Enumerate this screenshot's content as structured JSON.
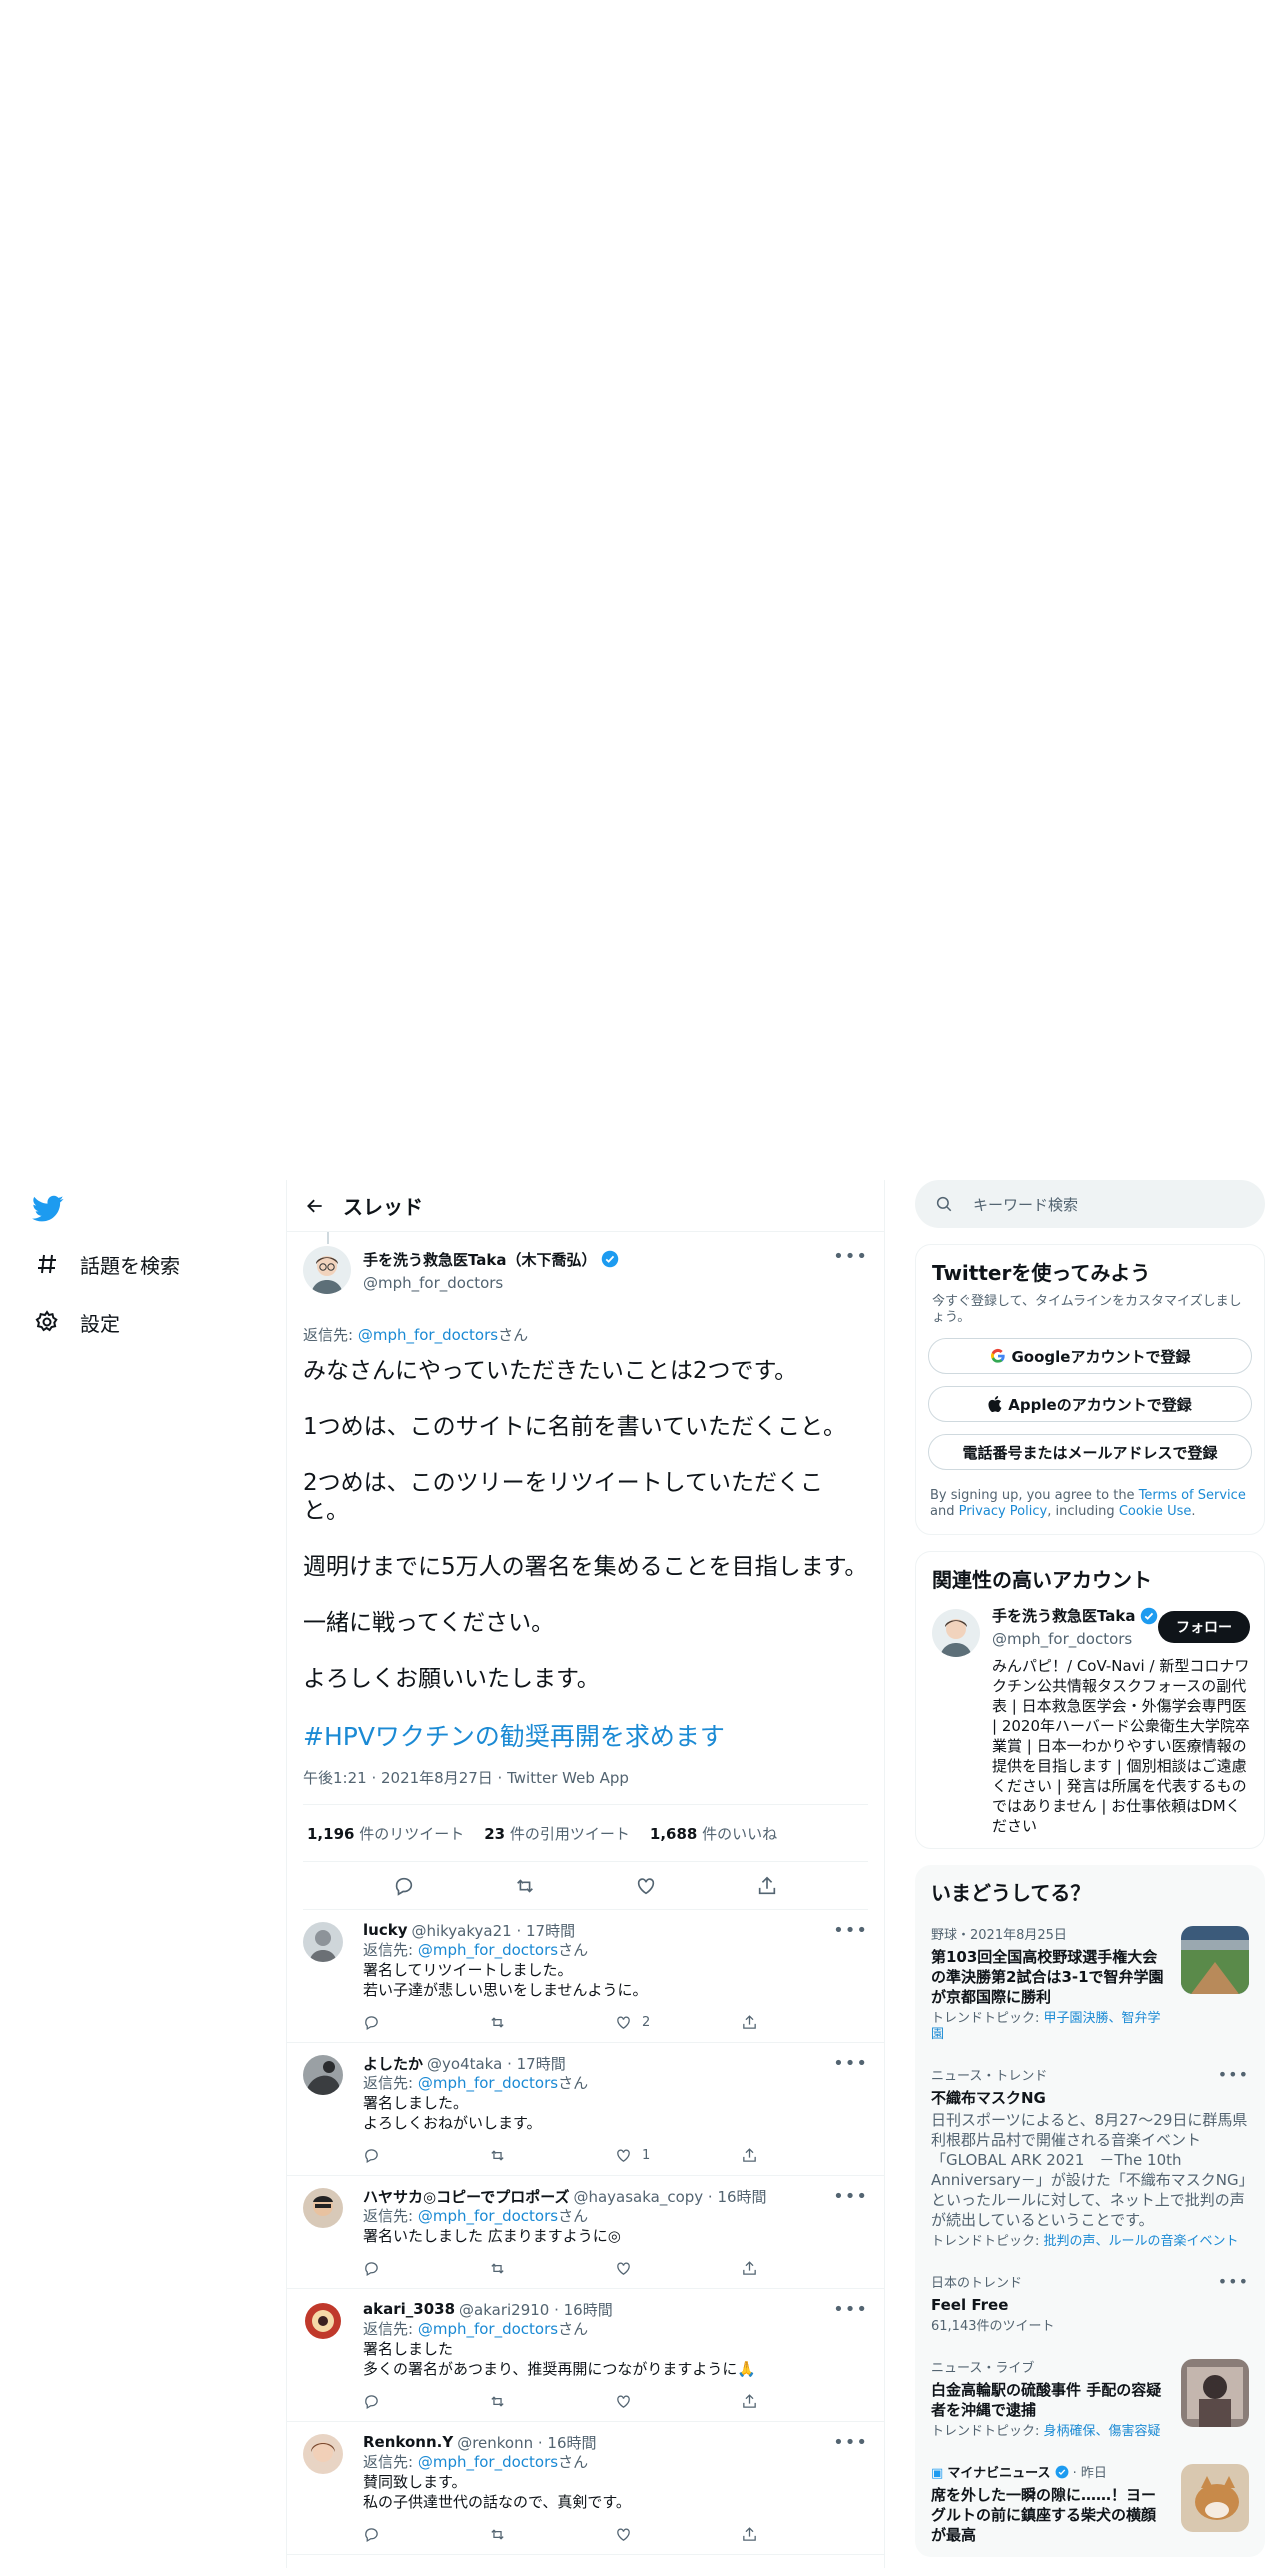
{
  "nav": {
    "items": [
      {
        "label": "話題を検索",
        "icon": "hashtag-icon"
      },
      {
        "label": "設定",
        "icon": "gear-icon"
      }
    ]
  },
  "header": {
    "title": "スレッド"
  },
  "main_tweet": {
    "display_name": "手を洗う救急医Taka（木下喬弘）",
    "handle": "@mph_for_doctors",
    "reply_prefix": "返信先: ",
    "reply_to": "@mph_for_doctors",
    "reply_suffix": "さん",
    "paragraphs": [
      "みなさんにやっていただきたいことは2つです。",
      "1つめは、このサイトに名前を書いていただくこと。",
      "2つめは、このツリーをリツイートしていただくこと。",
      "週明けまでに5万人の署名を集めることを目指します。",
      "一緒に戦ってください。",
      "よろしくお願いいたします。"
    ],
    "hashtag": "#HPVワクチンの勧奨再開を求めます",
    "meta": "午後1:21 · 2021年8月27日 · Twitter Web App",
    "stats": {
      "retweets_num": "1,196",
      "retweets_label": " 件のリツイート",
      "quotes_num": "23",
      "quotes_label": " 件の引用ツイート",
      "likes_num": "1,688",
      "likes_label": " 件のいいね"
    }
  },
  "replies": [
    {
      "name": "lucky",
      "handle": "@hikyakya21 · 17時間",
      "reply_prefix": "返信先: ",
      "reply_to": "@mph_for_doctors",
      "reply_suffix": "さん",
      "lines": [
        "署名してリツイートしました。",
        "若い子達が悲しい思いをしませんように。"
      ],
      "likes": "2"
    },
    {
      "name": "よしたか",
      "handle": "@yo4taka · 17時間",
      "reply_prefix": "返信先: ",
      "reply_to": "@mph_for_doctors",
      "reply_suffix": "さん",
      "lines": [
        "署名しました。",
        "よろしくおねがいします。"
      ],
      "likes": "1"
    },
    {
      "name": "ハヤサカ◎コピーでプロポーズ",
      "handle": "@hayasaka_copy · 16時間",
      "reply_prefix": "返信先: ",
      "reply_to": "@mph_for_doctors",
      "reply_suffix": "さん",
      "lines": [
        "署名いたしました 広まりますように◎"
      ],
      "likes": ""
    },
    {
      "name": "akari_3038",
      "handle": "@akari2910 · 16時間",
      "reply_prefix": "返信先: ",
      "reply_to": "@mph_for_doctors",
      "reply_suffix": "さん",
      "lines": [
        "署名しました",
        "多くの署名があつまり、推奨再開につながりますように🙏"
      ],
      "likes": ""
    },
    {
      "name": "Renkonn.Y",
      "handle": "@renkonn · 16時間",
      "reply_prefix": "返信先: ",
      "reply_to": "@mph_for_doctors",
      "reply_suffix": "さん",
      "lines": [
        "賛同致します。",
        "私の子供達世代の話なので、真剣です。"
      ],
      "likes": ""
    }
  ],
  "search": {
    "placeholder": "キーワード検索"
  },
  "signup": {
    "title": "Twitterを使ってみよう",
    "subtitle": "今すぐ登録して、タイムラインをカスタマイズしましょう。",
    "google": "Googleアカウントで登録",
    "apple": "Appleのアカウントで登録",
    "phone": "電話番号またはメールアドレスで登録",
    "legal_1": "By signing up, you agree to the ",
    "terms": "Terms of Service",
    "legal_2": " and ",
    "privacy": "Privacy Policy",
    "legal_3": ", including ",
    "cookie": "Cookie Use",
    "legal_4": "."
  },
  "related": {
    "title": "関連性の高いアカウント",
    "name": "手を洗う救急医Taka",
    "handle": "@mph_for_doctors",
    "follow": "フォロー",
    "bio": "みんパピ！/ CoV-Navi / 新型コロナワクチン公共情報タスクフォースの副代表 | 日本救急医学会・外傷学会専門医 | 2020年ハーバード公衆衛生大学院卒業賞 | 日本一わかりやすい医療情報の提供を目指します | 個別相談はご遠慮ください | 発言は所属を代表するものではありません | お仕事依頼はDMください"
  },
  "trends": {
    "title": "いまどうしてる？",
    "items": [
      {
        "context": "野球・2021年8月25日",
        "title": "第103回全国高校野球選手権大会の準決勝第2試合は3-1で智弁学園が京都国際に勝利",
        "topic_prefix": "トレンドトピック: ",
        "topic": "甲子園決勝、智弁学園"
      },
      {
        "context": "ニュース・トレンド",
        "title": "不織布マスクNG",
        "desc": "日刊スポーツによると、8月27〜29日に群馬県利根郡片品村で開催される音楽イベント「GLOBAL ARK 2021　－The 10th Anniversary－」が設けた「不織布マスクNG」といったルールに対して、ネット上で批判の声が続出しているということです。",
        "topic_prefix": "トレンドトピック: ",
        "topic": "批判の声、ルールの音楽イベント"
      },
      {
        "context": "日本のトレンド",
        "title": "Feel Free",
        "count": "61,143件のツイート"
      },
      {
        "context": "ニュース・ライブ",
        "title": "白金高輪駅の硫酸事件 手配の容疑者を沖縄で逮捕",
        "topic_prefix": "トレンドトピック: ",
        "topic": "身柄確保、傷害容疑"
      },
      {
        "context": "マイナビニュース",
        "context_time": " · 昨日",
        "title": "席を外した一瞬の隙に……！ヨーグルトの前に鎮座する柴犬の横顔が最高"
      }
    ]
  },
  "colors": {
    "accent": "#1d9bf0",
    "link": "#1b8ad4",
    "text": "#0f1419",
    "secondary": "#536471"
  }
}
